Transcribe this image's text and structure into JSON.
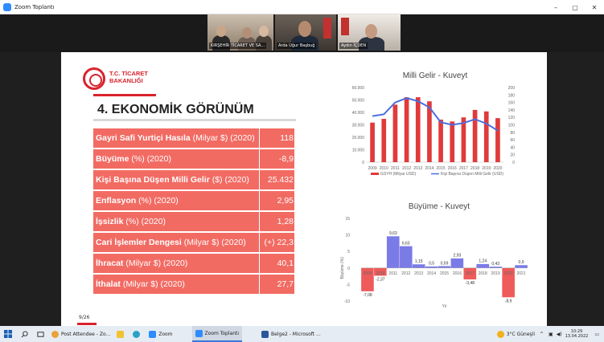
{
  "window": {
    "title": "Zoom Toplantı",
    "controls": [
      "–",
      "▢",
      "✕"
    ]
  },
  "participants": [
    {
      "name": "KIRŞEHİR TİCARET VE SA..."
    },
    {
      "name": "Arda Uğur Başbuğ"
    },
    {
      "name": "Aydın İÇDEN"
    }
  ],
  "slide": {
    "logo_line1": "T.C. TİCARET",
    "logo_line2": "BAKANLIĞI",
    "section_title": "4. EKONOMİK GÖRÜNÜM",
    "page_number": "9/26",
    "indicators": [
      {
        "bold": "Gayri Safi Yurtiçi Hasıla",
        "rest": " (Milyar $) (2020)",
        "value": "118"
      },
      {
        "bold": "Büyüme",
        "rest": " (%) (2020)",
        "value": "-8,9"
      },
      {
        "bold": "Kişi Başına Düşen Milli Gelir",
        "rest": " ($) (2020)",
        "value": "25.432"
      },
      {
        "bold": "Enflasyon",
        "rest": " (%) (2020)",
        "value": "2,95"
      },
      {
        "bold": "İşsizlik",
        "rest": " (%) (2020)",
        "value": "1,28"
      },
      {
        "bold": "Cari İşlemler Dengesi",
        "rest": " (Milyar $) (2020)",
        "value": "(+) 22,3"
      },
      {
        "bold": "İhracat",
        "rest": " (Milyar $) (2020)",
        "value": "40,1"
      },
      {
        "bold": "İthalat",
        "rest": " (Milyar $) (2020)",
        "value": "27,7"
      }
    ]
  },
  "chart_data": [
    {
      "type": "bar",
      "title": "Milli Gelir - Kuveyt",
      "categories": [
        "2009",
        "2010",
        "2011",
        "2012",
        "2013",
        "2014",
        "2015",
        "2016",
        "2017",
        "2018",
        "2019",
        "2020"
      ],
      "y_ticks": [
        "0",
        "10.000",
        "20.000",
        "30.000",
        "40.000",
        "50.000",
        "60.000"
      ],
      "y2_ticks": [
        "0",
        "20",
        "40",
        "60",
        "80",
        "100",
        "120",
        "140",
        "160",
        "180",
        "200"
      ],
      "ylim": [
        0,
        60000
      ],
      "y2lim": [
        0,
        200
      ],
      "series": [
        {
          "name": "GSYH (Milyar USD)",
          "kind": "bar",
          "axis": "right",
          "color": "#e03a3a",
          "values": [
            106,
            116,
            154,
            174,
            174,
            163,
            114,
            109,
            120,
            140,
            136,
            118
          ]
        },
        {
          "name": "Kişi Başına Düşen Milli Gelir (USD)",
          "kind": "line",
          "axis": "left",
          "color": "#4a6ee0",
          "values": [
            37000,
            38500,
            48000,
            51500,
            49000,
            44000,
            32000,
            30000,
            31500,
            34500,
            31000,
            25432
          ]
        }
      ]
    },
    {
      "type": "bar",
      "title": "Büyüme - Kuveyt",
      "xlabel": "Yıl",
      "ylabel": "Büyüme (%)",
      "ylim": [
        -10,
        15
      ],
      "y_ticks": [
        "-10",
        "-5",
        "0",
        "5",
        "10",
        "15"
      ],
      "categories": [
        "2009",
        "2010",
        "2011",
        "2012",
        "2013",
        "2014",
        "2015",
        "2016",
        "2017",
        "2018",
        "2019",
        "2020",
        "2021"
      ],
      "values": [
        -7.08,
        -2.37,
        9.63,
        6.63,
        1.15,
        0.5,
        0.59,
        2.93,
        -3.48,
        1.24,
        0.43,
        -8.9,
        0.9
      ],
      "labels": [
        "-7,08",
        "-2,37",
        "9,63",
        "6,63",
        "1,15",
        "0,5",
        "0,59",
        "2,93",
        "-3,48",
        "1,24",
        "0,43",
        "-8,9",
        "0,9"
      ],
      "positive_color": "#7b7be8",
      "negative_color": "#ef5a5a"
    }
  ],
  "taskbar": {
    "apps": [
      "Post Attendee - Zo...",
      "Zoom",
      "Zoom Toplantı",
      "Belge2 - Microsoft ..."
    ],
    "weather": "3°C Güneşli",
    "time": "10:29",
    "date": "13.04.2022"
  }
}
